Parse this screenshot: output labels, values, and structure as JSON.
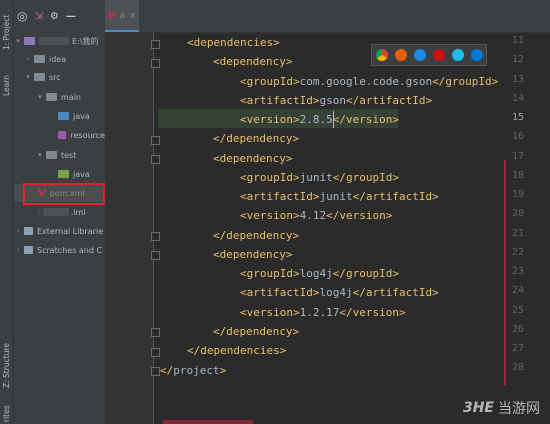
{
  "left_strip": {
    "project_label": "1: Project",
    "learn_label": "Learn",
    "structure_label": "Z: Structure",
    "favorites_label": "rites"
  },
  "project_tree": {
    "root_path": "E:\\我的",
    "items": [
      {
        "label": "idea"
      },
      {
        "label": "src"
      },
      {
        "label": "main"
      },
      {
        "label": "java"
      },
      {
        "label": "resource"
      },
      {
        "label": "test"
      },
      {
        "label": "java"
      },
      {
        "label": "pom.xml"
      },
      {
        "label": ".iml"
      },
      {
        "label": "External Librarie"
      },
      {
        "label": "Scratches and C"
      }
    ]
  },
  "tab": {
    "label": "a"
  },
  "browser_icons": [
    "chrome-icon",
    "firefox-icon",
    "safari-icon",
    "opera-icon",
    "ie-icon",
    "edge-icon"
  ],
  "code": {
    "line_numbers": [
      "11",
      "12",
      "13",
      "14",
      "15",
      "16",
      "17",
      "18",
      "19",
      "20",
      "21",
      "22",
      "23",
      "24",
      "25",
      "26",
      "27",
      "28"
    ],
    "dependencies_tag": "dependencies",
    "dependency_tag": "dependency",
    "groupId_tag": "groupId",
    "artifactId_tag": "artifactId",
    "version_tag": "version",
    "project_tag": "project",
    "deps": [
      {
        "group": "com.google.code.gson",
        "artifact": "gson",
        "version": "2.8.5"
      },
      {
        "group": "junit",
        "artifact": "junit",
        "version": "4.12"
      },
      {
        "group": "log4j",
        "artifact": "log4j",
        "version": "1.2.17"
      }
    ]
  },
  "watermark": {
    "text": "当游网"
  },
  "colors": {
    "tag": "#e8bf6a",
    "text": "#a9b7c6",
    "highlight": "#344134",
    "annotation_red": "#e0242c"
  }
}
